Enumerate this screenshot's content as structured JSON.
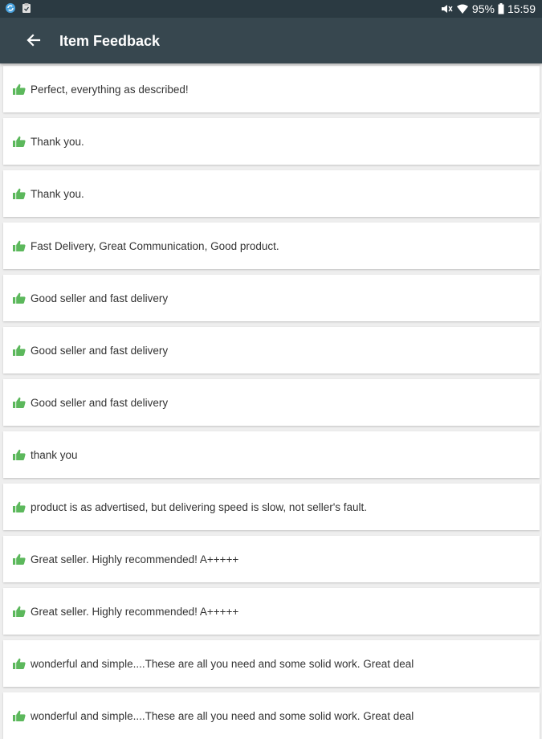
{
  "status_bar": {
    "battery": "95%",
    "time": "15:59",
    "left_icons": [
      "sync-icon",
      "clipboard-icon"
    ],
    "right_icons": [
      "mute-icon",
      "wifi-icon",
      "battery-icon"
    ]
  },
  "app_bar": {
    "back_icon": "arrow-back-icon",
    "title": "Item Feedback"
  },
  "colors": {
    "status_bar": "#2b3a42",
    "app_bar": "#37474f",
    "thumb_positive": "#5cb85c",
    "background": "#eeeeee"
  },
  "feedback": [
    {
      "rating": "positive",
      "text": "Perfect, everything as described!"
    },
    {
      "rating": "positive",
      "text": "Thank you."
    },
    {
      "rating": "positive",
      "text": "Thank you."
    },
    {
      "rating": "positive",
      "text": "Fast Delivery, Great Communication, Good product."
    },
    {
      "rating": "positive",
      "text": "Good seller and fast delivery"
    },
    {
      "rating": "positive",
      "text": "Good seller and fast delivery"
    },
    {
      "rating": "positive",
      "text": "Good seller and fast delivery"
    },
    {
      "rating": "positive",
      "text": "thank you"
    },
    {
      "rating": "positive",
      "text": "product is as advertised, but delivering speed is slow, not seller's fault."
    },
    {
      "rating": "positive",
      "text": "Great seller. Highly recommended! A+++++"
    },
    {
      "rating": "positive",
      "text": "Great seller. Highly recommended! A+++++"
    },
    {
      "rating": "positive",
      "text": "wonderful and simple....These are all you need and some solid work. Great deal"
    },
    {
      "rating": "positive",
      "text": "wonderful and simple....These are all you need and some solid work. Great deal"
    }
  ]
}
